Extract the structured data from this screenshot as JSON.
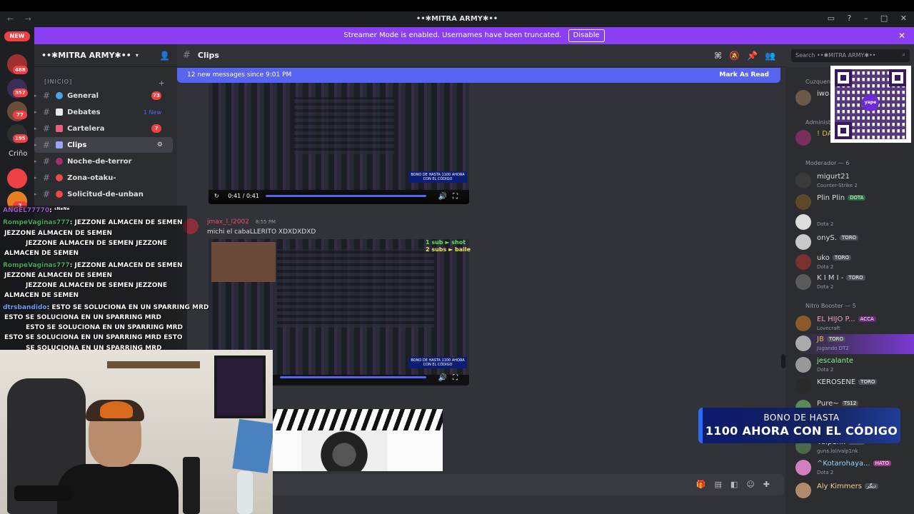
{
  "window": {
    "title": "••✱MITRA ARMY✱••",
    "nav": "← →"
  },
  "banner": {
    "text": "Streamer Mode is enabled. Usernames have been truncated.",
    "button": "Disable",
    "close": "✕"
  },
  "guilds": {
    "new_pill": "NEW",
    "badges": [
      "488",
      "357",
      "77",
      "195",
      "3"
    ],
    "text_item": "Criño"
  },
  "server": {
    "name": "••✱MITRA ARMY✱••",
    "category": "[INICIO]",
    "channels": [
      {
        "name": "General",
        "badge": "73"
      },
      {
        "name": "Debates",
        "badge": "1 New"
      },
      {
        "name": "Cartelera",
        "badge": "7"
      },
      {
        "name": "Clips",
        "badge": ""
      },
      {
        "name": "Noche-de-terror",
        "badge": ""
      },
      {
        "name": "Zona-otaku-",
        "badge": ""
      },
      {
        "name": "Solicitud-de-unban",
        "badge": ""
      }
    ]
  },
  "chat": {
    "channel": "Clips",
    "search_placeholder": "Search ••✱MITRA ARMY✱••",
    "new_messages": "12 new messages since 9:01 PM",
    "mark_as_read": "Mark As Read",
    "clip_time": "0:41 / 0:41",
    "author": "jmax_l_l2002",
    "timestamp": "8:55 PM",
    "message": "michi el cabaLLERITO XDXDXDXD",
    "subs_line1": "1 sub ► shot",
    "subs_line2": "2 subs ► baile",
    "promo_small": "BONO DE HASTA 1100 AHORA CON EL CÓDIGO"
  },
  "members": {
    "groups": [
      "Cuzquen",
      "Administ",
      "Moderador — 6",
      "Nitro Booster — 5"
    ],
    "list": [
      {
        "name": "iwo",
        "status": "",
        "tag": ""
      },
      {
        "name": "! DA",
        "status": "",
        "tag": ""
      },
      {
        "name": "migurt21",
        "status": "Counter-Strike 2",
        "tag": ""
      },
      {
        "name": "Plin Plin",
        "status": "",
        "tag": "DOTA"
      },
      {
        "name": "",
        "status": "Dota 2",
        "tag": ""
      },
      {
        "name": "onyS.",
        "status": "",
        "tag": "TORO"
      },
      {
        "name": "uko",
        "status": "Dota 2",
        "tag": "TORO"
      },
      {
        "name": "K I M I -",
        "status": "Dota 2",
        "tag": "TORO"
      },
      {
        "name": "EL HIJO P...",
        "status": "Lovecraft",
        "tag": "ACCA"
      },
      {
        "name": "JB",
        "status": "Jugando DT2",
        "tag": "TORO"
      },
      {
        "name": "jescalante",
        "status": "Dota 2",
        "tag": ""
      },
      {
        "name": "KEROSENE",
        "status": "",
        "tag": "TORO"
      },
      {
        "name": "Pure~",
        "status": "",
        "tag": "TS12"
      },
      {
        "name": "Valp1nk",
        "status": "guns.lol/valp1nk",
        "tag": "LIMA"
      },
      {
        "name": "^Kotarohaya...",
        "status": "Dota 2",
        "tag": "HATO"
      },
      {
        "name": "Aly Kimmers",
        "status": "",
        "tag": "دیگر"
      }
    ]
  },
  "qr": {
    "logo": "yape"
  },
  "bono": {
    "line1": "BONO DE HASTA",
    "line2": "1100 AHORA CON EL CÓDIGO"
  },
  "overlay_chat": [
    {
      "user": "ANGEL77770",
      "text": ": ᶜᴺᵉᴺᵉ"
    },
    {
      "user": "RompeVaginas777",
      "text": ": JEZZONE ALMACEN DE SEMEN"
    },
    {
      "user": "",
      "text": "JEZZONE ALMACEN DE SEMEN"
    },
    {
      "user": "",
      "text": "JEZZONE ALMACEN DE SEMEN            JEZZONE"
    },
    {
      "user": "",
      "text": "ALMACEN DE SEMEN"
    },
    {
      "user": "RompeVaginas777",
      "text": ": JEZZONE ALMACEN DE SEMEN"
    },
    {
      "user": "",
      "text": "JEZZONE ALMACEN DE SEMEN"
    },
    {
      "user": "",
      "text": "JEZZONE ALMACEN DE SEMEN            JEZZONE"
    },
    {
      "user": "",
      "text": "ALMACEN DE SEMEN"
    },
    {
      "user": "dtrsbandido",
      "text": ": ESTO SE SOLUCIONA EN UN SPARRING MRD"
    },
    {
      "user": "",
      "text": "ESTO SE SOLUCIONA EN UN SPARRING MRD"
    },
    {
      "user": "",
      "text": "ESTO SE SOLUCIONA EN UN SPARRING MRD"
    },
    {
      "user": "",
      "text": "ESTO SE SOLUCIONA EN UN SPARRING MRD        ESTO"
    },
    {
      "user": "",
      "text": "SE SOLUCIONA EN UN SPARRING MRD"
    }
  ],
  "colors": {
    "banner": "#8b3ff2",
    "blurple": "#5865f2",
    "red_badge": "#f23f43"
  }
}
